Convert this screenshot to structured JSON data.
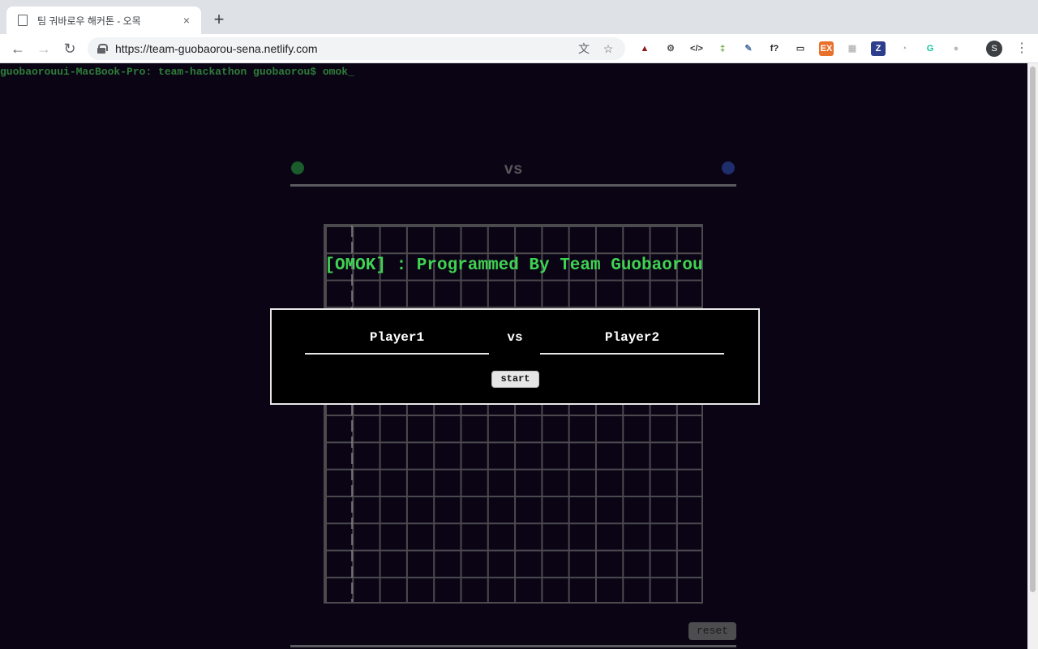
{
  "browser": {
    "tab_title": "팀 궈바로우 해커톤 - 오목",
    "url": "https://team-guobaorou-sena.netlify.com",
    "new_tab_label": "+",
    "tab_close": "×",
    "avatar_initial": "S",
    "extensions": [
      {
        "name": "hat-extension-icon",
        "glyph": "▲",
        "color": "#8b1a1a"
      },
      {
        "name": "settings-extension-icon",
        "glyph": "⚙",
        "color": "#555555"
      },
      {
        "name": "code-extension-icon",
        "glyph": "</>",
        "color": "#333333"
      },
      {
        "name": "ladder-extension-icon",
        "glyph": "‡",
        "color": "#5aa02c"
      },
      {
        "name": "eyedropper-extension-icon",
        "glyph": "✎",
        "color": "#4a6fa5"
      },
      {
        "name": "font-extension-icon",
        "glyph": "f?",
        "color": "#222222"
      },
      {
        "name": "cast-icon",
        "glyph": "▭",
        "color": "#444444"
      },
      {
        "name": "ex-extension-icon",
        "glyph": "EX",
        "color": "#e8712b"
      },
      {
        "name": "grid-extension-icon",
        "glyph": "▦",
        "color": "#bbbbbb"
      },
      {
        "name": "z-extension-icon",
        "glyph": "Z",
        "color": "#2c3e8c"
      },
      {
        "name": "clock-extension-icon",
        "glyph": "◔",
        "color": "#aaaaaa"
      },
      {
        "name": "grammarly-icon",
        "glyph": "G",
        "color": "#15c39a"
      },
      {
        "name": "discord-extension-icon",
        "glyph": "●",
        "color": "#bbbbbb"
      }
    ]
  },
  "terminal": {
    "prompt": "guobaorouui-MacBook-Pro: team-hackathon guobaorou$ omok_"
  },
  "scoreboard": {
    "vs": "vs",
    "player1_color": "#1a5c2c",
    "player2_color": "#1e2d6b"
  },
  "banner": "[OMOK] : Programmed By Team Guobaorou",
  "modal": {
    "player1": "Player1",
    "vs": "vs",
    "player2": "Player2",
    "start": "start"
  },
  "controls": {
    "reset": "reset"
  }
}
